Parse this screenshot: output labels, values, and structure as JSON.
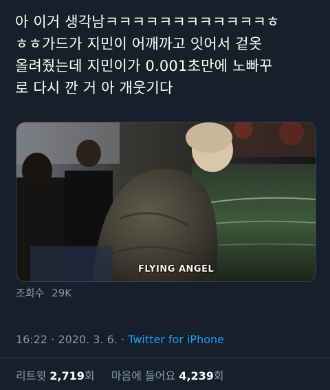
{
  "tweet": {
    "text_lines": [
      "아 이거 생각남ㅋㅋㅋㅋㅋㅋㅋㅋㅋㅋㅋㅋㅎ",
      "ㅎㅎ가드가 지민이 어깨까고 잇어서 겉옷",
      "올려줬는데 지민이가 0.001초만에 노빠꾸",
      "로 다시 깐 거 아 개웃기다"
    ],
    "media_watermark": "FLYING ANGEL",
    "views_label": "조회수",
    "views_count": "29K",
    "time": "16:22",
    "date": "2020. 3. 6.",
    "dot": "·",
    "source": "Twitter for iPhone",
    "retweets_label": "리트윗",
    "retweets_count": "2,719",
    "retweets_unit": "회",
    "likes_label": "마음에 들어요",
    "likes_count": "4,239",
    "likes_unit": "회"
  },
  "colors": {
    "background": "#15202b",
    "text": "#ffffff",
    "secondary": "#8899a6",
    "link": "#1da1f2",
    "divider": "#38444d"
  }
}
